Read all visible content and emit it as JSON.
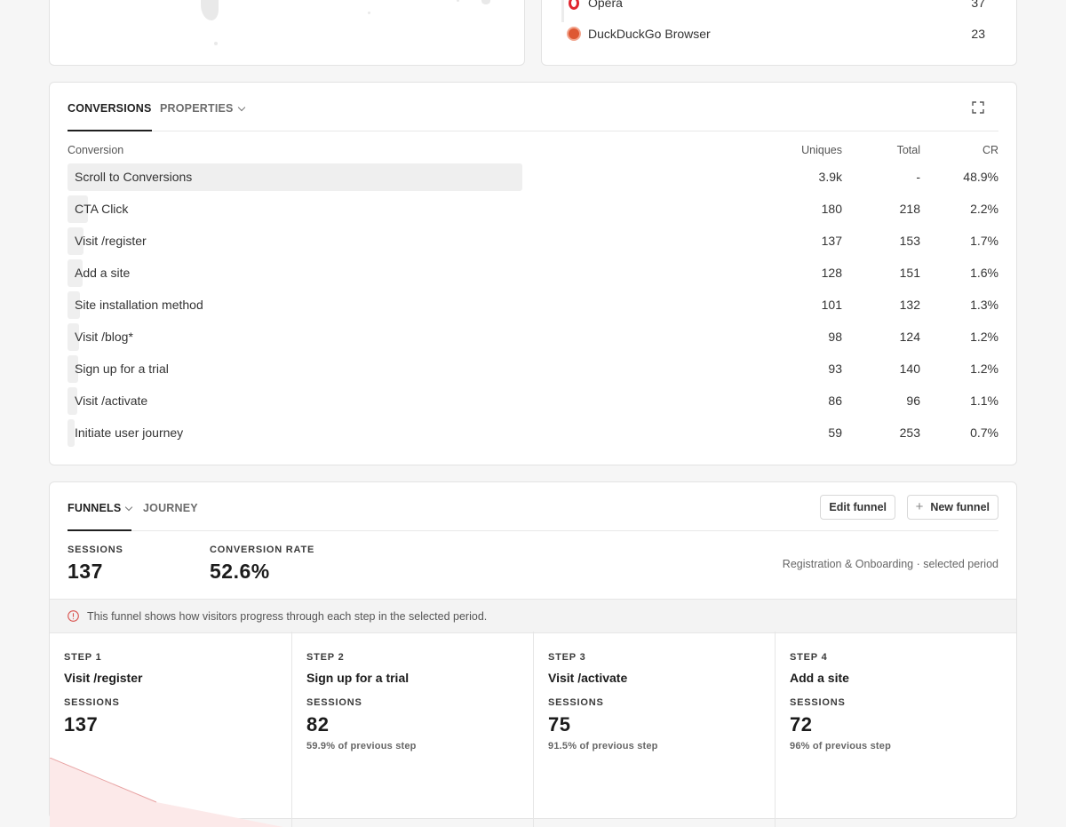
{
  "browsers": [
    {
      "name": "Opera",
      "value": "37",
      "icon": "opera-icon",
      "color": "#e0262f"
    },
    {
      "name": "DuckDuckGo Browser",
      "value": "23",
      "icon": "duckduckgo-icon",
      "color": "#de5833"
    }
  ],
  "conversions": {
    "tabs": [
      {
        "label": "CONVERSIONS",
        "active": true
      },
      {
        "label": "PROPERTIES",
        "active": false
      }
    ],
    "columns": {
      "name": "Conversion",
      "uniques": "Uniques",
      "total": "Total",
      "cr": "CR"
    },
    "rows": [
      {
        "name": "Scroll to Conversions",
        "uniques": "3.9k",
        "total": "-",
        "cr": "48.9%",
        "bar_fraction": 1.0
      },
      {
        "name": "CTA Click",
        "uniques": "180",
        "total": "218",
        "cr": "2.2%",
        "bar_fraction": 0.045
      },
      {
        "name": "Visit /register",
        "uniques": "137",
        "total": "153",
        "cr": "1.7%",
        "bar_fraction": 0.035
      },
      {
        "name": "Add a site",
        "uniques": "128",
        "total": "151",
        "cr": "1.6%",
        "bar_fraction": 0.033
      },
      {
        "name": "Site installation method",
        "uniques": "101",
        "total": "132",
        "cr": "1.3%",
        "bar_fraction": 0.027
      },
      {
        "name": "Visit /blog*",
        "uniques": "98",
        "total": "124",
        "cr": "1.2%",
        "bar_fraction": 0.025
      },
      {
        "name": "Sign up for a trial",
        "uniques": "93",
        "total": "140",
        "cr": "1.2%",
        "bar_fraction": 0.024
      },
      {
        "name": "Visit /activate",
        "uniques": "86",
        "total": "96",
        "cr": "1.1%",
        "bar_fraction": 0.022
      },
      {
        "name": "Initiate user journey",
        "uniques": "59",
        "total": "253",
        "cr": "0.7%",
        "bar_fraction": 0.015
      }
    ]
  },
  "funnels": {
    "tabs": [
      {
        "label": "FUNNELS",
        "active": true
      },
      {
        "label": "JOURNEY",
        "active": false
      }
    ],
    "edit_label": "Edit funnel",
    "new_label": "New funnel",
    "sessions_label": "SESSIONS",
    "sessions_value": "137",
    "conversion_label": "CONVERSION RATE",
    "conversion_value": "52.6%",
    "subtitle": "Registration & Onboarding · selected period",
    "notice": "This funnel shows how visitors progress through each step in the selected period.",
    "steps": [
      {
        "step": "STEP 1",
        "name": "Visit /register",
        "sessions_label": "SESSIONS",
        "value": "137",
        "pct": ""
      },
      {
        "step": "STEP 2",
        "name": "Sign up for a trial",
        "sessions_label": "SESSIONS",
        "value": "82",
        "pct": "59.9% of previous step"
      },
      {
        "step": "STEP 3",
        "name": "Visit /activate",
        "sessions_label": "SESSIONS",
        "value": "75",
        "pct": "91.5% of previous step"
      },
      {
        "step": "STEP 4",
        "name": "Add a site",
        "sessions_label": "SESSIONS",
        "value": "72",
        "pct": "96% of previous step"
      }
    ]
  },
  "colors": {
    "accent_fill": "#fce9e9",
    "accent_line": "#e8a3a3",
    "info": "#d9534f"
  }
}
